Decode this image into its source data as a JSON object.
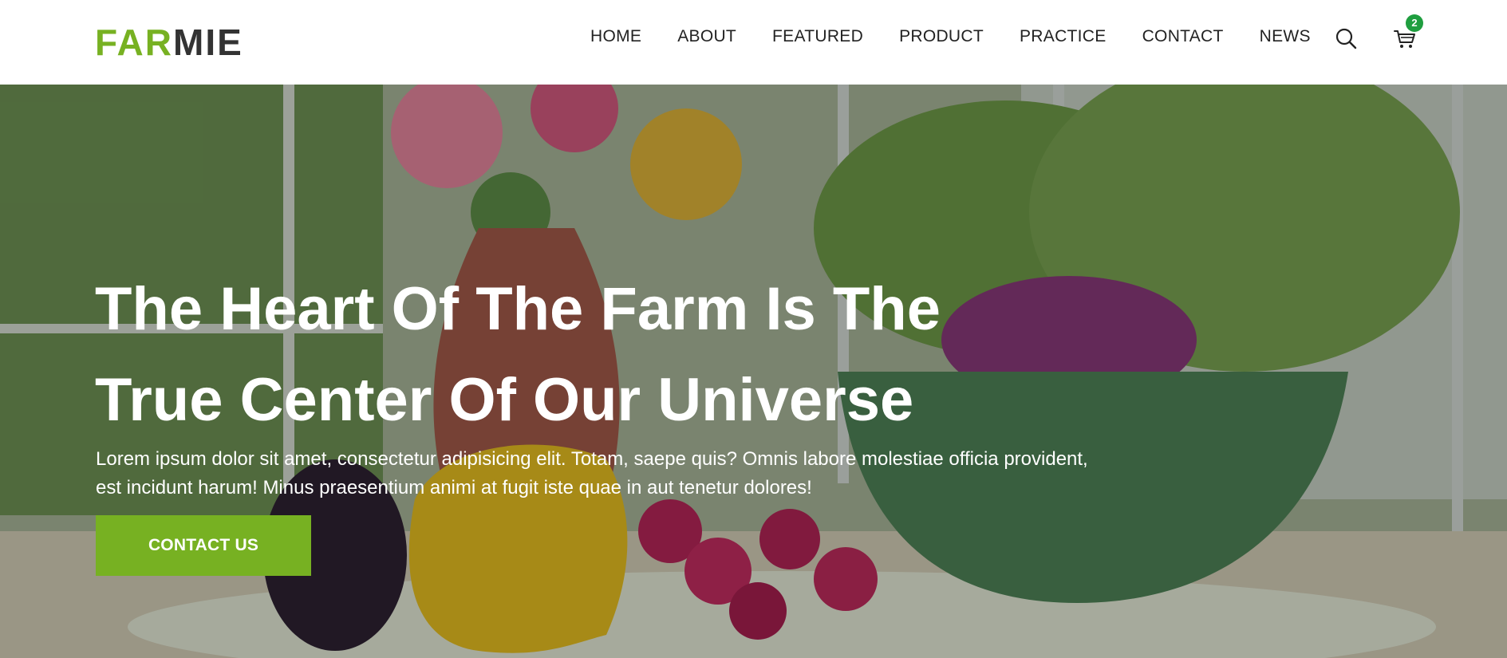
{
  "logo": {
    "part1": "FAR",
    "part2": "MIE"
  },
  "nav": {
    "items": [
      "HOME",
      "ABOUT",
      "FEATURED",
      "PRODUCT",
      "PRACTICE",
      "CONTACT",
      "NEWS"
    ]
  },
  "header_icons": {
    "search": "search-icon",
    "cart": "cart-icon",
    "cart_count": "2"
  },
  "hero": {
    "title_line1": "The Heart Of The Farm Is The",
    "title_line2": "True Center Of Our Universe",
    "text": "Lorem ipsum dolor sit amet, consectetur adipisicing elit. Totam, saepe quis? Omnis labore molestiae officia provident, est incidunt harum! Minus praesentium animi at fugit iste quae in aut tenetur dolores!",
    "cta_label": "CONTACT US"
  },
  "colors": {
    "brand_green": "#77b122",
    "badge_green": "#1f9e3f",
    "text_dark": "#222222"
  }
}
